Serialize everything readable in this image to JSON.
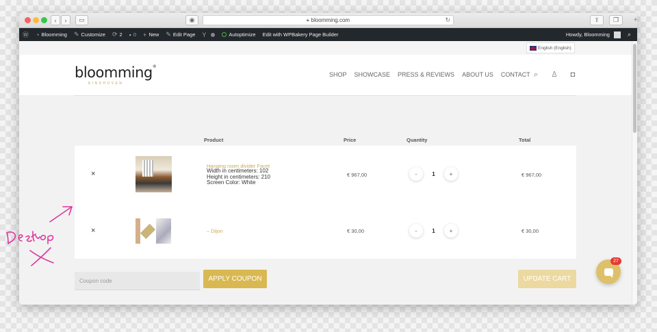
{
  "browser": {
    "url": "bloomming.com",
    "reload_icon": "reload-icon",
    "back_icon": "back-icon",
    "forward_icon": "forward-icon"
  },
  "admin_bar": {
    "site_name": "Bloomming",
    "customize": "Customize",
    "updates_count": "2",
    "comments_count": "0",
    "new_label": "New",
    "edit_page": "Edit Page",
    "autoptimize": "Autoptimize",
    "wpbakery": "Edit with WPBakery Page Builder",
    "howdy": "Howdy, Bloomming"
  },
  "language": {
    "label": "English (English)"
  },
  "header": {
    "logo_main": "bloomming",
    "logo_mark": "®",
    "logo_sub": "EINDHOVEN",
    "nav": [
      "SHOP",
      "SHOWCASE",
      "PRESS & REVIEWS",
      "ABOUT US",
      "CONTACT"
    ]
  },
  "cart": {
    "columns": {
      "product": "Product",
      "price": "Price",
      "quantity": "Quantity",
      "total": "Total"
    },
    "items": [
      {
        "remove": "×",
        "name": "Hanging room divider Facet",
        "meta": [
          "Width in centimeters: 102",
          "Height in centimeters: 210",
          "Screen Color: White"
        ],
        "price": "€ 967,00",
        "quantity": "1",
        "total": "€ 967,00"
      },
      {
        "remove": "×",
        "name": "– Dijon",
        "meta": [],
        "price": "€ 30,00",
        "quantity": "1",
        "total": "€ 30,00"
      }
    ],
    "minus": "-",
    "plus": "+",
    "coupon_placeholder": "Coupon code",
    "apply_label": "APPLY COUPON",
    "update_label": "UPDATE CART"
  },
  "chat": {
    "badge": "27"
  },
  "annotation": {
    "text": "Desktop",
    "color": "#e0359b"
  },
  "colors": {
    "accent_gold": "#d9b852",
    "admin_bar": "#23282d",
    "badge_red": "#e53935"
  }
}
